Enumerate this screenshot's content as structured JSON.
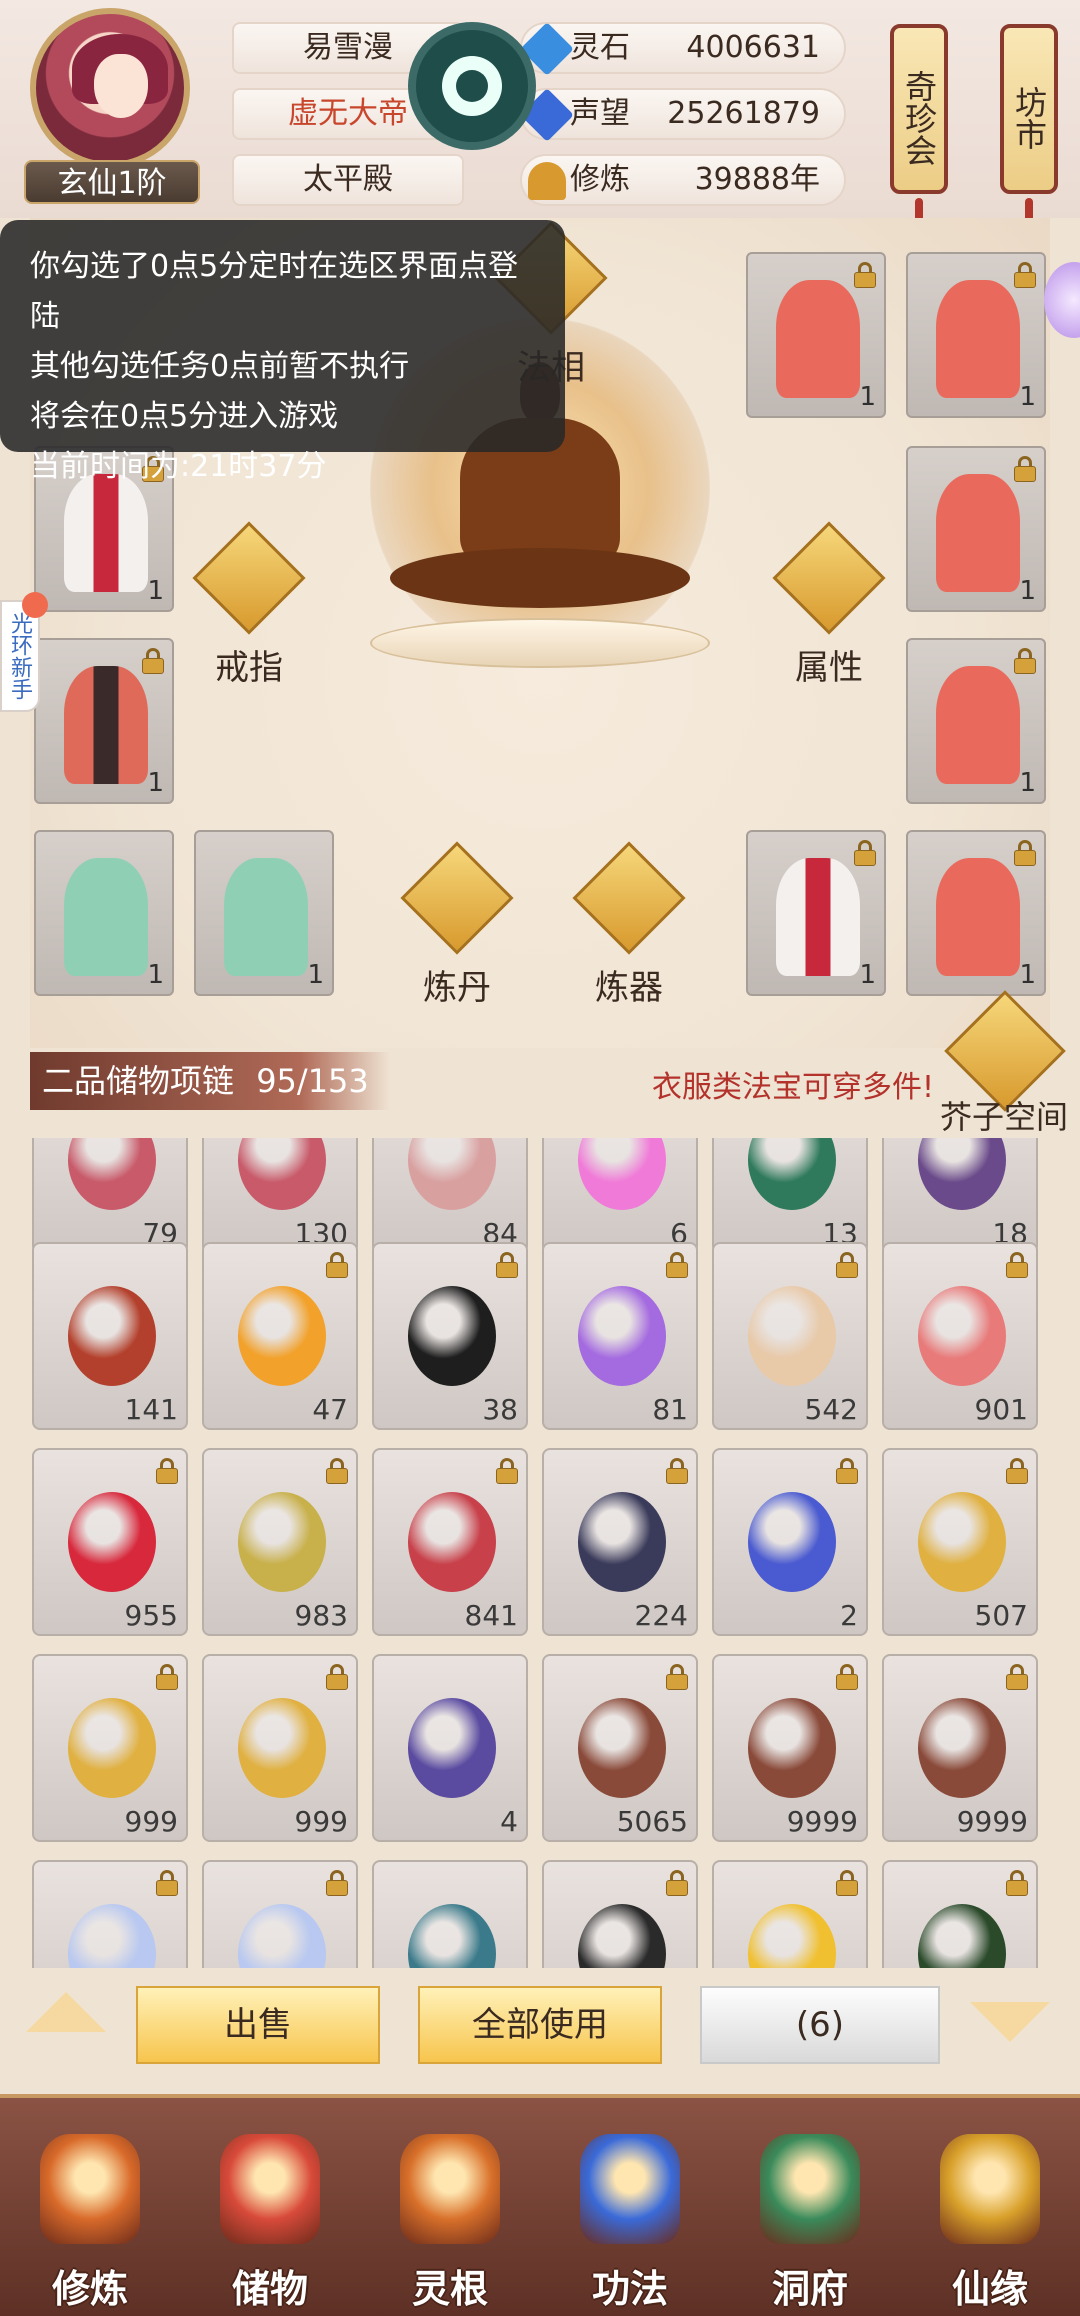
{
  "header": {
    "rank": "玄仙1阶",
    "player_name": "易雪漫",
    "title": "虚无大帝",
    "location": "太平殿",
    "resources": [
      {
        "label": "灵石",
        "value": "4006631",
        "icon": "spirit-stone-icon"
      },
      {
        "label": "声望",
        "value": "25261879",
        "icon": "prestige-icon"
      },
      {
        "label": "修炼",
        "value": "39888年",
        "icon": "cultivation-icon"
      }
    ],
    "signs": [
      {
        "label": "奇珍会"
      },
      {
        "label": "坊市"
      }
    ],
    "colors": {
      "title": "#c8462c",
      "accent": "#d89a2e"
    }
  },
  "notice": {
    "lines": [
      "你勾选了0点5分定时在选区界面点登陆",
      "其他勾选任务0点前暂不执行",
      "将会在0点5分进入游戏",
      "当前时间为:21时37分"
    ]
  },
  "side_tab": {
    "label": "光环新手"
  },
  "equipment": {
    "center_labels": {
      "top": "法相",
      "left": "戒指",
      "right": "属性",
      "bottom_left": "炼丹",
      "bottom_right": "炼器"
    },
    "slots": [
      {
        "id": "r1c4",
        "count": "1",
        "color": "#e96a5c"
      },
      {
        "id": "r1c5",
        "count": "1",
        "color": "#e96a5c"
      },
      {
        "id": "r2c1",
        "count": "1",
        "color": "#e6e3e0"
      },
      {
        "id": "r2c5",
        "count": "1",
        "color": "#e96a5c"
      },
      {
        "id": "r3c1",
        "count": "1",
        "color": "#e06a5a"
      },
      {
        "id": "r3c5",
        "count": "1",
        "color": "#e96a5c"
      },
      {
        "id": "r4c1",
        "count": "1",
        "color": "#8fd0b4"
      },
      {
        "id": "r4c2",
        "count": "1",
        "color": "#8fd0b4"
      },
      {
        "id": "r4c4",
        "count": "1",
        "color": "#e6e3e0"
      },
      {
        "id": "r4c5",
        "count": "1",
        "color": "#e96a5c"
      }
    ]
  },
  "bag": {
    "title": "二品储物项链",
    "capacity": "95/153",
    "note": "衣服类法宝可穿多件!",
    "box_label": "芥子空间",
    "rows": [
      [
        {
          "count": "79",
          "color": "#c85a6a",
          "locked": false
        },
        {
          "count": "130",
          "color": "#c85a6a",
          "locked": false
        },
        {
          "count": "84",
          "color": "#d9a0a0",
          "locked": false
        },
        {
          "count": "6",
          "color": "#f07ad8",
          "locked": false
        },
        {
          "count": "13",
          "color": "#2f7a5c",
          "locked": false
        },
        {
          "count": "18",
          "color": "#6a4a8a",
          "locked": false
        }
      ],
      [
        {
          "count": "141",
          "color": "#b3402c",
          "locked": false
        },
        {
          "count": "47",
          "color": "#f2a12a",
          "locked": true
        },
        {
          "count": "38",
          "color": "#1e1e1e",
          "locked": true
        },
        {
          "count": "81",
          "color": "#a46ae0",
          "locked": true
        },
        {
          "count": "542",
          "color": "#e8c9a8",
          "locked": true
        },
        {
          "count": "901",
          "color": "#e87a7a",
          "locked": true
        }
      ],
      [
        {
          "count": "955",
          "color": "#d8283c",
          "locked": true
        },
        {
          "count": "983",
          "color": "#c8b04a",
          "locked": true
        },
        {
          "count": "841",
          "color": "#c8404a",
          "locked": true
        },
        {
          "count": "224",
          "color": "#3a3a5a",
          "locked": true
        },
        {
          "count": "2",
          "color": "#4a5ad0",
          "locked": true
        },
        {
          "count": "507",
          "color": "#e0b040",
          "locked": true
        }
      ],
      [
        {
          "count": "999",
          "color": "#e0b040",
          "locked": true
        },
        {
          "count": "999",
          "color": "#e0b040",
          "locked": true
        },
        {
          "count": "4",
          "color": "#5a4aa0",
          "locked": false
        },
        {
          "count": "5065",
          "color": "#8a4a3a",
          "locked": true
        },
        {
          "count": "9999",
          "color": "#8a4a3a",
          "locked": true
        },
        {
          "count": "9999",
          "color": "#8a4a3a",
          "locked": true
        }
      ],
      [
        {
          "count": "",
          "color": "#b8c8f0",
          "locked": true
        },
        {
          "count": "",
          "color": "#b8c8f0",
          "locked": true
        },
        {
          "count": "",
          "color": "#3a7a8a",
          "locked": false
        },
        {
          "count": "",
          "color": "#2a2a2a",
          "locked": true
        },
        {
          "count": "",
          "color": "#f0c030",
          "locked": true
        },
        {
          "count": "",
          "color": "#2a4a2a",
          "locked": true
        }
      ]
    ]
  },
  "actions": {
    "sell": "出售",
    "use_all": "全部使用",
    "count": "(6)"
  },
  "nav": [
    {
      "label": "修炼",
      "icon": "cultivate-icon",
      "color": "#d86a2a"
    },
    {
      "label": "储物",
      "icon": "storage-bag-icon",
      "color": "#d84a3a"
    },
    {
      "label": "灵根",
      "icon": "spirit-root-icon",
      "color": "#d8702a"
    },
    {
      "label": "功法",
      "icon": "scripture-icon",
      "color": "#3a6ad8"
    },
    {
      "label": "洞府",
      "icon": "cave-house-icon",
      "color": "#3a8a5a"
    },
    {
      "label": "仙缘",
      "icon": "immortal-fate-icon",
      "color": "#d8a02a"
    }
  ]
}
